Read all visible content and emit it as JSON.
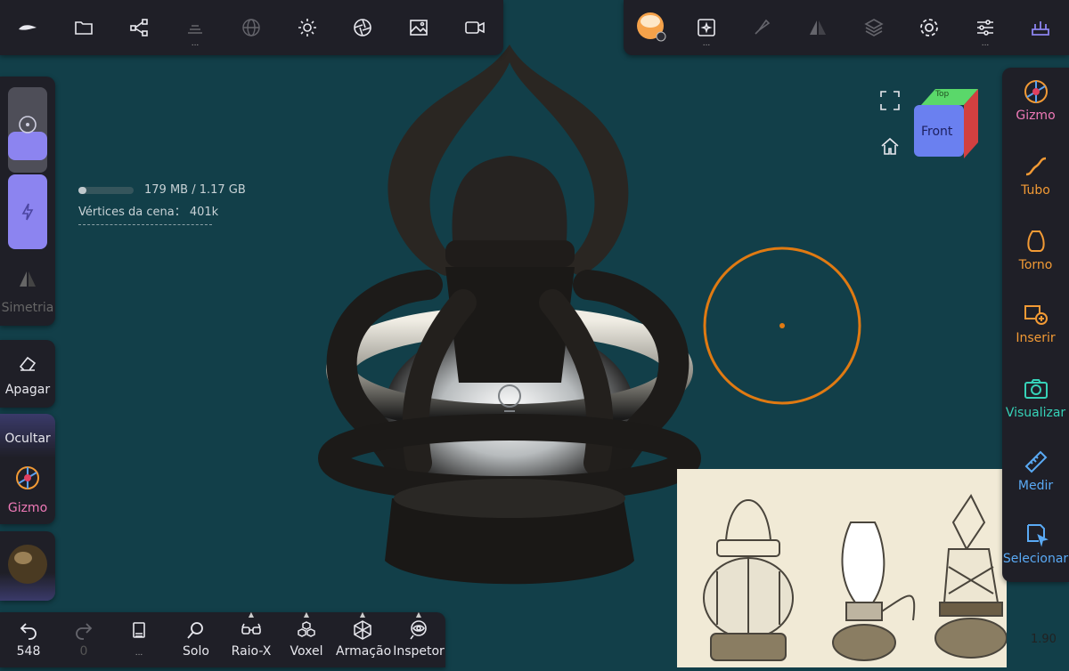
{
  "memory": {
    "text": "179 MB / 1.17 GB",
    "fill": 0.15
  },
  "scene_vertices": "Vértices da cena： 401k",
  "left_tools": {
    "symmetry": "Simetria",
    "erase": "Apagar",
    "hide": "Ocultar",
    "gizmo": "Gizmo"
  },
  "right_tools": [
    {
      "label": "Gizmo",
      "icon": "gizmo-icon"
    },
    {
      "label": "Tubo",
      "icon": "tube-icon"
    },
    {
      "label": "Torno",
      "icon": "lathe-icon"
    },
    {
      "label": "Inserir",
      "icon": "insert-icon"
    },
    {
      "label": "Visualizar",
      "icon": "camera-icon"
    },
    {
      "label": "Medir",
      "icon": "ruler-icon"
    },
    {
      "label": "Selecionar",
      "icon": "select-icon"
    }
  ],
  "bottom_bar": {
    "undo_count": "548",
    "redo_count": "0",
    "solo": "Solo",
    "xray": "Raio-X",
    "voxel": "Voxel",
    "wireframe": "Armação",
    "inspector": "Inspetor"
  },
  "view_cube": {
    "front": "Front",
    "top": "Top"
  },
  "zoom": "1.90",
  "colors": {
    "accent": "#f29a35",
    "slider": "#8c84f0",
    "gizmo_label": "#f07ab8"
  }
}
